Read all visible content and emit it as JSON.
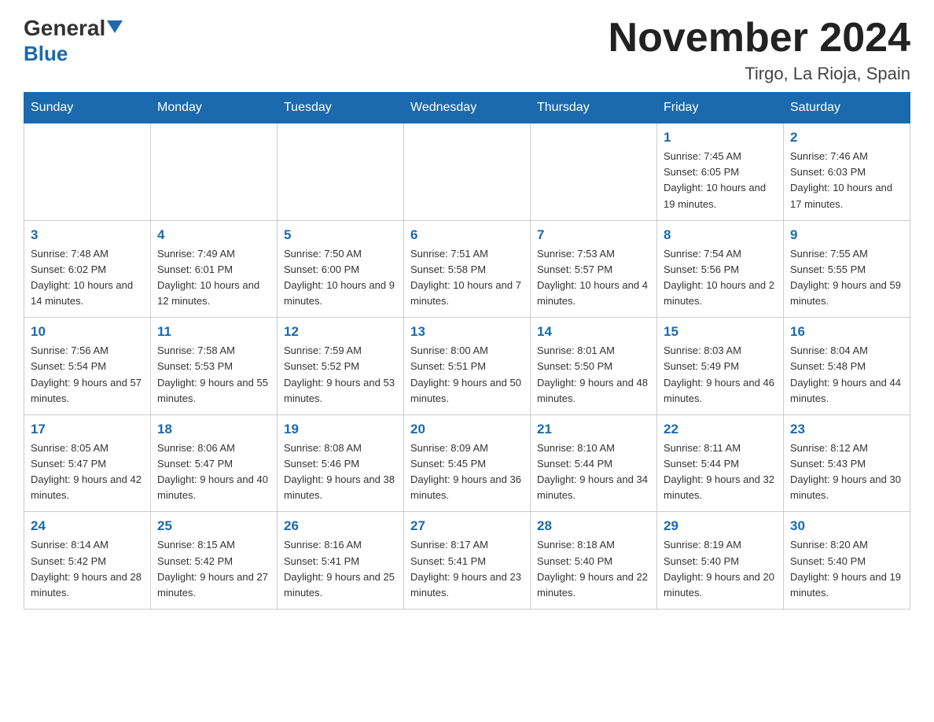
{
  "header": {
    "logo": {
      "part1": "General",
      "part2": "Blue"
    },
    "title": "November 2024",
    "location": "Tirgo, La Rioja, Spain"
  },
  "weekdays": [
    "Sunday",
    "Monday",
    "Tuesday",
    "Wednesday",
    "Thursday",
    "Friday",
    "Saturday"
  ],
  "weeks": [
    [
      {
        "day": "",
        "info": ""
      },
      {
        "day": "",
        "info": ""
      },
      {
        "day": "",
        "info": ""
      },
      {
        "day": "",
        "info": ""
      },
      {
        "day": "",
        "info": ""
      },
      {
        "day": "1",
        "info": "Sunrise: 7:45 AM\nSunset: 6:05 PM\nDaylight: 10 hours and 19 minutes."
      },
      {
        "day": "2",
        "info": "Sunrise: 7:46 AM\nSunset: 6:03 PM\nDaylight: 10 hours and 17 minutes."
      }
    ],
    [
      {
        "day": "3",
        "info": "Sunrise: 7:48 AM\nSunset: 6:02 PM\nDaylight: 10 hours and 14 minutes."
      },
      {
        "day": "4",
        "info": "Sunrise: 7:49 AM\nSunset: 6:01 PM\nDaylight: 10 hours and 12 minutes."
      },
      {
        "day": "5",
        "info": "Sunrise: 7:50 AM\nSunset: 6:00 PM\nDaylight: 10 hours and 9 minutes."
      },
      {
        "day": "6",
        "info": "Sunrise: 7:51 AM\nSunset: 5:58 PM\nDaylight: 10 hours and 7 minutes."
      },
      {
        "day": "7",
        "info": "Sunrise: 7:53 AM\nSunset: 5:57 PM\nDaylight: 10 hours and 4 minutes."
      },
      {
        "day": "8",
        "info": "Sunrise: 7:54 AM\nSunset: 5:56 PM\nDaylight: 10 hours and 2 minutes."
      },
      {
        "day": "9",
        "info": "Sunrise: 7:55 AM\nSunset: 5:55 PM\nDaylight: 9 hours and 59 minutes."
      }
    ],
    [
      {
        "day": "10",
        "info": "Sunrise: 7:56 AM\nSunset: 5:54 PM\nDaylight: 9 hours and 57 minutes."
      },
      {
        "day": "11",
        "info": "Sunrise: 7:58 AM\nSunset: 5:53 PM\nDaylight: 9 hours and 55 minutes."
      },
      {
        "day": "12",
        "info": "Sunrise: 7:59 AM\nSunset: 5:52 PM\nDaylight: 9 hours and 53 minutes."
      },
      {
        "day": "13",
        "info": "Sunrise: 8:00 AM\nSunset: 5:51 PM\nDaylight: 9 hours and 50 minutes."
      },
      {
        "day": "14",
        "info": "Sunrise: 8:01 AM\nSunset: 5:50 PM\nDaylight: 9 hours and 48 minutes."
      },
      {
        "day": "15",
        "info": "Sunrise: 8:03 AM\nSunset: 5:49 PM\nDaylight: 9 hours and 46 minutes."
      },
      {
        "day": "16",
        "info": "Sunrise: 8:04 AM\nSunset: 5:48 PM\nDaylight: 9 hours and 44 minutes."
      }
    ],
    [
      {
        "day": "17",
        "info": "Sunrise: 8:05 AM\nSunset: 5:47 PM\nDaylight: 9 hours and 42 minutes."
      },
      {
        "day": "18",
        "info": "Sunrise: 8:06 AM\nSunset: 5:47 PM\nDaylight: 9 hours and 40 minutes."
      },
      {
        "day": "19",
        "info": "Sunrise: 8:08 AM\nSunset: 5:46 PM\nDaylight: 9 hours and 38 minutes."
      },
      {
        "day": "20",
        "info": "Sunrise: 8:09 AM\nSunset: 5:45 PM\nDaylight: 9 hours and 36 minutes."
      },
      {
        "day": "21",
        "info": "Sunrise: 8:10 AM\nSunset: 5:44 PM\nDaylight: 9 hours and 34 minutes."
      },
      {
        "day": "22",
        "info": "Sunrise: 8:11 AM\nSunset: 5:44 PM\nDaylight: 9 hours and 32 minutes."
      },
      {
        "day": "23",
        "info": "Sunrise: 8:12 AM\nSunset: 5:43 PM\nDaylight: 9 hours and 30 minutes."
      }
    ],
    [
      {
        "day": "24",
        "info": "Sunrise: 8:14 AM\nSunset: 5:42 PM\nDaylight: 9 hours and 28 minutes."
      },
      {
        "day": "25",
        "info": "Sunrise: 8:15 AM\nSunset: 5:42 PM\nDaylight: 9 hours and 27 minutes."
      },
      {
        "day": "26",
        "info": "Sunrise: 8:16 AM\nSunset: 5:41 PM\nDaylight: 9 hours and 25 minutes."
      },
      {
        "day": "27",
        "info": "Sunrise: 8:17 AM\nSunset: 5:41 PM\nDaylight: 9 hours and 23 minutes."
      },
      {
        "day": "28",
        "info": "Sunrise: 8:18 AM\nSunset: 5:40 PM\nDaylight: 9 hours and 22 minutes."
      },
      {
        "day": "29",
        "info": "Sunrise: 8:19 AM\nSunset: 5:40 PM\nDaylight: 9 hours and 20 minutes."
      },
      {
        "day": "30",
        "info": "Sunrise: 8:20 AM\nSunset: 5:40 PM\nDaylight: 9 hours and 19 minutes."
      }
    ]
  ]
}
